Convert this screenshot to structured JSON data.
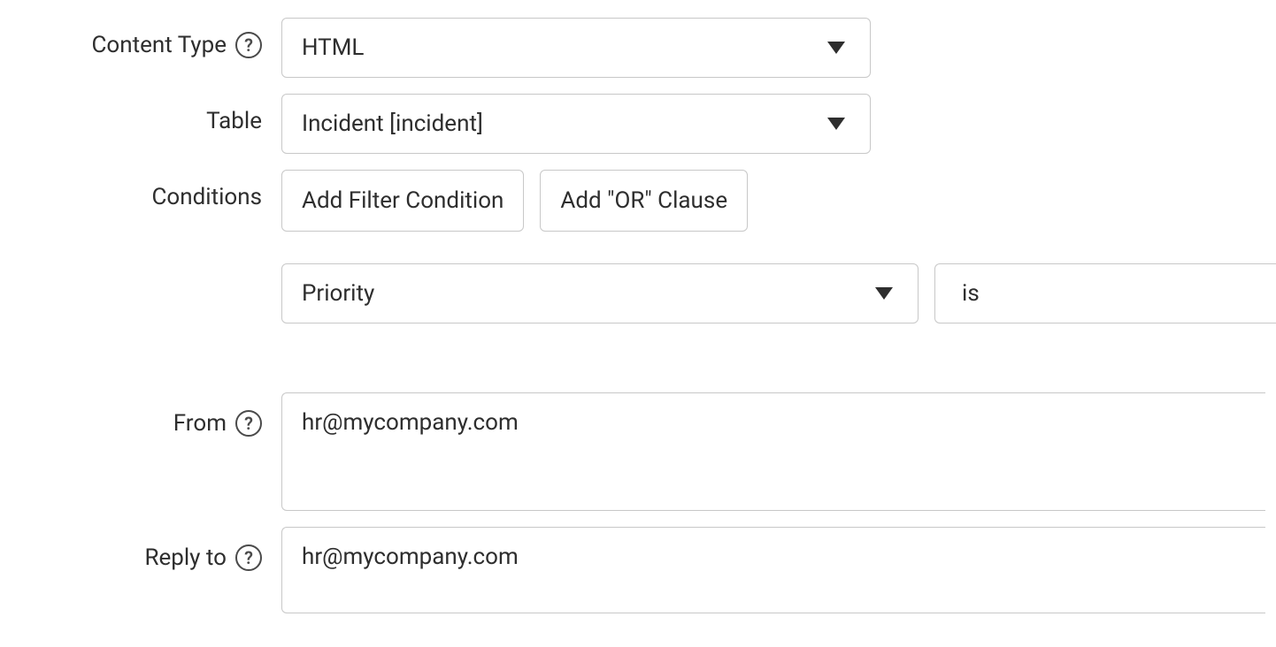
{
  "labels": {
    "content_type": "Content Type",
    "table": "Table",
    "conditions": "Conditions",
    "from": "From",
    "reply_to": "Reply to"
  },
  "values": {
    "content_type": "HTML",
    "table": "Incident [incident]",
    "condition_field": "Priority",
    "condition_operator": "is",
    "from": "hr@mycompany.com",
    "reply_to": "hr@mycompany.com"
  },
  "buttons": {
    "add_filter_condition": "Add Filter Condition",
    "add_or_clause": "Add \"OR\" Clause"
  },
  "icons": {
    "help": "?"
  }
}
